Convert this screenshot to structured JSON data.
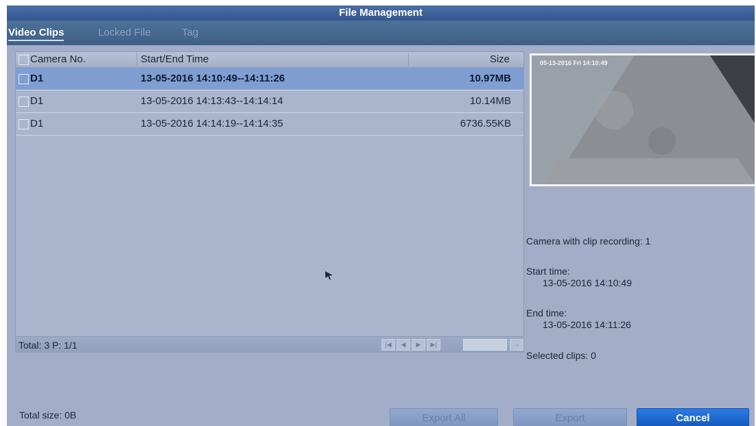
{
  "window": {
    "title": "File Management"
  },
  "tabs": [
    {
      "label": "Video Clips",
      "active": true
    },
    {
      "label": "Locked File",
      "active": false
    },
    {
      "label": "Tag",
      "active": false
    }
  ],
  "table": {
    "columns": {
      "camera": "Camera No.",
      "time": "Start/End Time",
      "size": "Size"
    },
    "rows": [
      {
        "camera": "D1",
        "time": "13-05-2016 14:10:49--14:11:26",
        "size": "10.97MB",
        "selected": true
      },
      {
        "camera": "D1",
        "time": "13-05-2016 14:13:43--14:14:14",
        "size": "10.14MB",
        "selected": false
      },
      {
        "camera": "D1",
        "time": "13-05-2016 14:14:19--14:14:35",
        "size": "6736.55KB",
        "selected": false
      }
    ],
    "footer": {
      "total": "Total: 3  P: 1/1"
    }
  },
  "preview": {
    "osd": "05-13-2016 Fri 14:10:49"
  },
  "details": {
    "camera_with_clip": "Camera with clip recording: 1",
    "start_label": "Start time:",
    "start_value": "13-05-2016 14:10:49",
    "end_label": "End time:",
    "end_value": "13-05-2016 14:11:26",
    "selected_clips": "Selected clips: 0"
  },
  "bottom": {
    "total_size": "Total size: 0B",
    "export_all": "Export All",
    "export": "Export",
    "cancel": "Cancel"
  },
  "colors": {
    "accent": "#1a62c8",
    "selected_row": "#7f9ed2",
    "background": "#a2aec8"
  }
}
